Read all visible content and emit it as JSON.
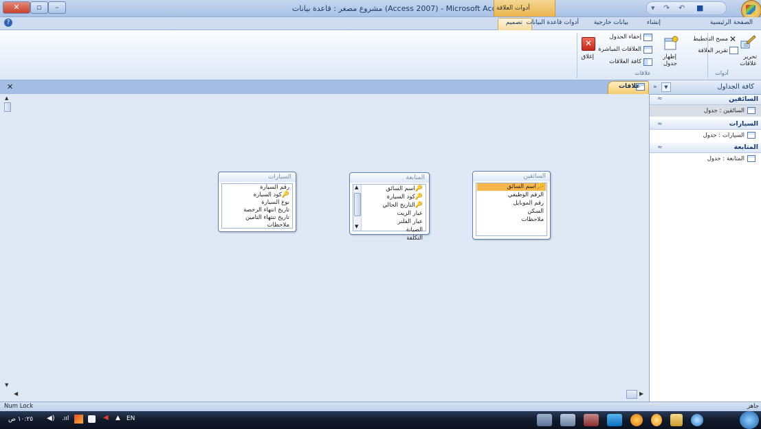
{
  "window": {
    "title": "مشروع مصغر : قاعدة بيانات (Access 2007) - Microsoft Access",
    "context_tab_group": "أدوات العلاقة"
  },
  "ribbon": {
    "tabs": [
      "الصفحة الرئيسية",
      "إنشاء",
      "بيانات خارجية",
      "أدوات قاعدة البيانات",
      "تصميم"
    ],
    "groups": {
      "tools": {
        "label": "أدوات",
        "edit_relationships_line1": "تحرير",
        "edit_relationships_line2": "علاقات",
        "clear_layout": "مسح التخطيط",
        "relationship_report": "تقرير العلاقة"
      },
      "relationships": {
        "label": "علاقات",
        "show_table_line1": "إظهار",
        "show_table_line2": "جدول",
        "hide_table": "إخفاء الجدول",
        "direct_relationships": "العلاقات المباشرة",
        "all_relationships": "كافة العلاقات",
        "close": "إغلاق"
      }
    }
  },
  "document": {
    "tab_label": "علاقات",
    "tables": [
      {
        "name": "السائقين",
        "fields": [
          {
            "name": "اسم السائق",
            "key": true,
            "selected": true
          },
          {
            "name": "الرقم الوظيفي",
            "key": false
          },
          {
            "name": "رقم الموبايل",
            "key": false
          },
          {
            "name": "السكن",
            "key": false
          },
          {
            "name": "ملاحظات",
            "key": false
          }
        ]
      },
      {
        "name": "المتابعة",
        "fields": [
          {
            "name": "اسم السائق",
            "key": true
          },
          {
            "name": "كود السيارة",
            "key": true
          },
          {
            "name": "التاريخ الحالي",
            "key": true
          },
          {
            "name": "عيار الزيت",
            "key": false
          },
          {
            "name": "عيار الفلتر",
            "key": false
          },
          {
            "name": "الصيانة",
            "key": false
          },
          {
            "name": "التكلفة",
            "key": false
          }
        ]
      },
      {
        "name": "السيارات",
        "fields": [
          {
            "name": "رقم السيارة",
            "key": false
          },
          {
            "name": "كود السيارة",
            "key": true
          },
          {
            "name": "نوع السيارة",
            "key": false
          },
          {
            "name": "تاريخ انتهاء الرخصة",
            "key": false
          },
          {
            "name": "تاريخ تنتهاء التامين",
            "key": false
          },
          {
            "name": "ملاحظات",
            "key": false
          }
        ]
      }
    ]
  },
  "nav_pane": {
    "header": "كافة الجداول",
    "groups": [
      {
        "name": "السائقين",
        "item": "السائقين : جدول",
        "selected": true
      },
      {
        "name": "السيارات",
        "item": "السيارات : جدول",
        "selected": false
      },
      {
        "name": "المتابعة",
        "item": "المتابعة : جدول",
        "selected": false
      }
    ]
  },
  "statusbar": {
    "left": "Num Lock",
    "right": "جاهز"
  },
  "taskbar": {
    "clock": "١٠:٢٥ ص",
    "language": "EN"
  },
  "colors": {
    "accent": "#2f66b4",
    "context_tab": "#f6cc6c",
    "selected_field": "#f7b64a"
  }
}
